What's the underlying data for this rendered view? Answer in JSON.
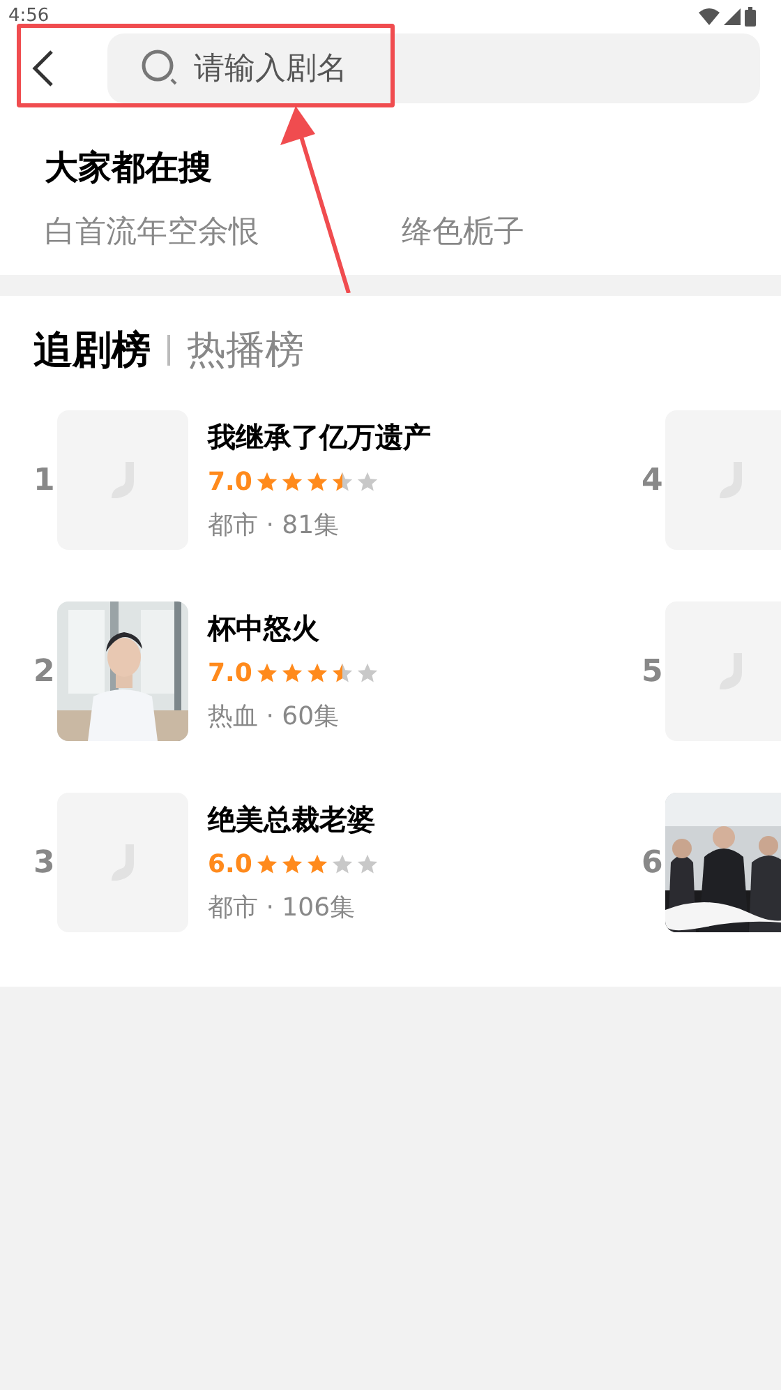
{
  "status_bar": {
    "time": "4:56"
  },
  "search": {
    "placeholder": "请输入剧名"
  },
  "hot_search": {
    "title": "大家都在搜",
    "items": [
      "白首流年空余恨",
      "绛色栀子"
    ]
  },
  "tabs": [
    {
      "label": "追剧榜",
      "selected": true
    },
    {
      "label": "热播榜",
      "selected": false
    }
  ],
  "ranking": [
    {
      "rank": "1",
      "kind": "placeholder",
      "title": "我继承了亿万遗产",
      "score": "7.0",
      "stars": 3.5,
      "meta": "都市 · 81集"
    },
    {
      "rank": "2",
      "kind": "picture",
      "title": "杯中怒火",
      "score": "7.0",
      "stars": 3.5,
      "meta": "热血 · 60集"
    },
    {
      "rank": "3",
      "kind": "placeholder",
      "title": "绝美总裁老婆",
      "score": "6.0",
      "stars": 3,
      "meta": "都市 · 106集"
    },
    {
      "rank": "4",
      "kind": "placeholder"
    },
    {
      "rank": "5",
      "kind": "placeholder"
    },
    {
      "rank": "6",
      "kind": "picture"
    }
  ]
}
